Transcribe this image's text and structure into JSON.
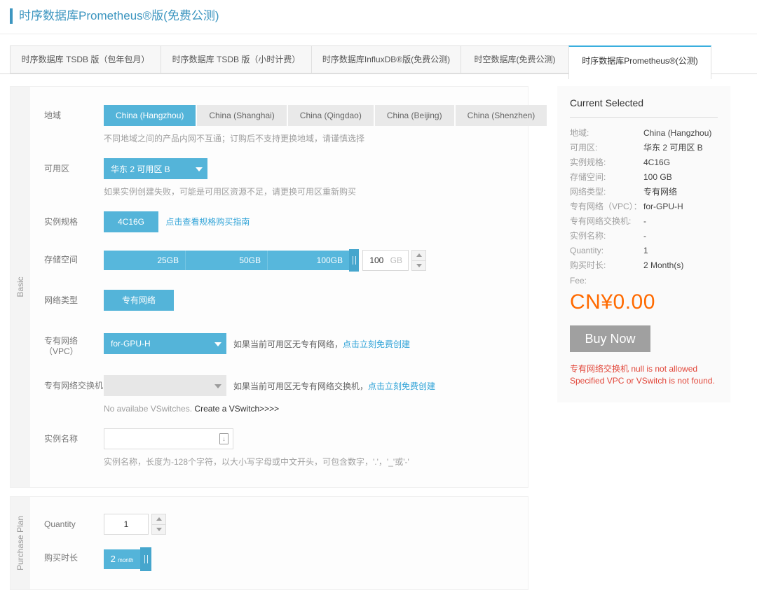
{
  "page_title": "时序数据库Prometheus®版(免费公测)",
  "tabs": [
    {
      "label": "时序数据库 TSDB 版（包年包月）",
      "active": false
    },
    {
      "label": "时序数据库 TSDB 版（小时计费）",
      "active": false
    },
    {
      "label": "时序数据库InfluxDB®版(免费公测)",
      "active": false
    },
    {
      "label": "时空数据库(免费公测)",
      "active": false
    },
    {
      "label": "时序数据库Prometheus®(公测)",
      "active": true
    }
  ],
  "basic": {
    "section_label": "Basic",
    "region": {
      "label": "地域",
      "options": [
        {
          "label": "China (Hangzhou)",
          "selected": true
        },
        {
          "label": "China (Shanghai)",
          "selected": false
        },
        {
          "label": "China (Qingdao)",
          "selected": false
        },
        {
          "label": "China (Beijing)",
          "selected": false
        },
        {
          "label": "China (Shenzhen)",
          "selected": false
        }
      ],
      "note": "不同地域之间的产品内网不互通；订购后不支持更换地域，请谨慎选择"
    },
    "zone": {
      "label": "可用区",
      "value": "华东 2 可用区 B",
      "note": "如果实例创建失败，可能是可用区资源不足，请更换可用区重新购买"
    },
    "spec": {
      "label": "实例规格",
      "value": "4C16G",
      "link": "点击查看规格购买指南"
    },
    "storage": {
      "label": "存储空间",
      "ticks": [
        "25GB",
        "50GB",
        "100GB"
      ],
      "value": "100",
      "unit": "GB"
    },
    "network_type": {
      "label": "网络类型",
      "value": "专有网络"
    },
    "vpc": {
      "label_line1": "专有网络",
      "label_line2": "（VPC）",
      "value": "for-GPU-H",
      "note": "如果当前可用区无专有网络，",
      "link": "点击立刻免费创建"
    },
    "vswitch": {
      "label": "专有网络交换机",
      "value": "",
      "note": "如果当前可用区无专有网络交换机，",
      "link": "点击立刻免费创建",
      "empty_note": "No availabe VSwitches. ",
      "empty_link": "Create a VSwitch>>>>"
    },
    "instance_name": {
      "label": "实例名称",
      "value": "",
      "note": "实例名称，长度为-128个字符，以大小写字母或中文开头，可包含数字，'.'，'_'或'-'"
    }
  },
  "purchase_plan": {
    "section_label": "Purchase Plan",
    "quantity": {
      "label": "Quantity",
      "value": "1"
    },
    "duration": {
      "label": "购买时长",
      "value": "2",
      "unit": "month"
    }
  },
  "summary": {
    "title": "Current Selected",
    "rows": [
      {
        "label": "地域:",
        "value": "China (Hangzhou)"
      },
      {
        "label": "可用区:",
        "value": "华东 2 可用区 B"
      },
      {
        "label": "实例规格:",
        "value": "4C16G"
      },
      {
        "label": "存储空间:",
        "value": "100 GB"
      },
      {
        "label": "网络类型:",
        "value": "专有网络"
      },
      {
        "label": "专有网络（VPC）：",
        "value": "for-GPU-H"
      },
      {
        "label": "专有网络交换机:",
        "value": "-"
      },
      {
        "label": "实例名称:",
        "value": "-"
      },
      {
        "label": "Quantity:",
        "value": "1"
      },
      {
        "label": "购买时长:",
        "value": "2 Month(s)"
      }
    ],
    "fee_label": "Fee:",
    "fee": "CN¥0.00",
    "buy_button": "Buy Now",
    "error_line1": "专有网络交换机 null is not allowed",
    "error_line2": "Specified VPC or VSwitch is not found."
  },
  "colors": {
    "primary_blue": "#54b4d9",
    "handle_blue": "#46a6cd",
    "fee_orange": "#ff6a00",
    "error_red": "#e2473a",
    "link_blue": "#32a4d8",
    "title_blue": "#3d96c0"
  }
}
